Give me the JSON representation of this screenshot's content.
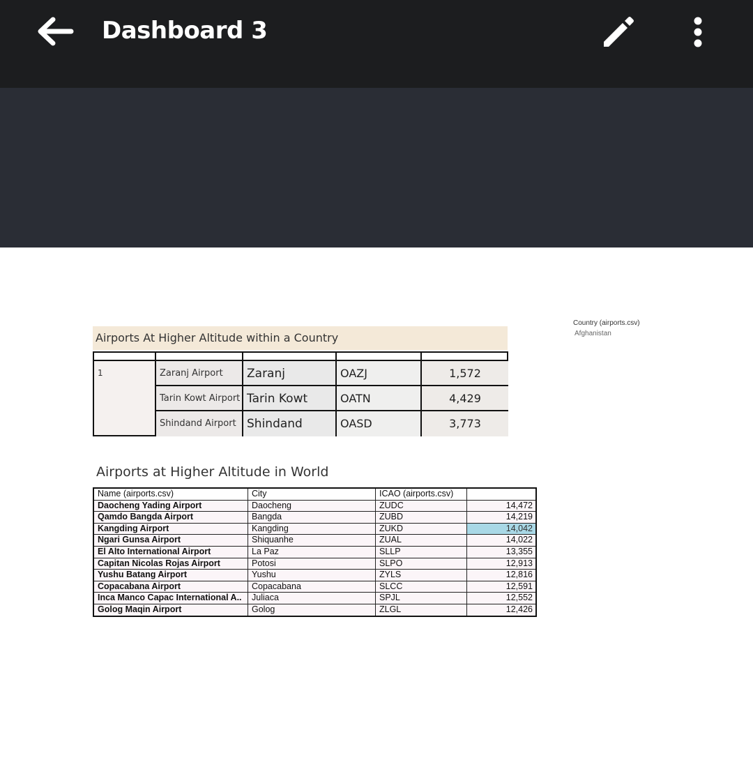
{
  "app_bar": {
    "title": "Dashboard 3",
    "back_icon": "arrow-left-icon",
    "edit_icon": "pencil-icon",
    "more_icon": "more-vert-icon"
  },
  "colors": {
    "app_bar": "#1c1d1f",
    "banner": "#2a2d35",
    "title_band": "#f4e9d8",
    "highlight_cell": "#a9d8e6"
  },
  "filter": {
    "label": "Country (airports.csv)",
    "value": "Afghanistan"
  },
  "country_table": {
    "title": "Airports At Higher Altitude within a Country",
    "rank": "1",
    "rows": [
      {
        "name": "Zaranj Airport",
        "city": "Zaranj",
        "icao": "OAZJ",
        "altitude": "1,572"
      },
      {
        "name": "Tarin Kowt Airport",
        "city": "Tarin Kowt",
        "icao": "OATN",
        "altitude": "4,429"
      },
      {
        "name": "Shindand Airport",
        "city": "Shindand",
        "icao": "OASD",
        "altitude": "3,773"
      }
    ]
  },
  "world_table": {
    "title": "Airports at Higher Altitude in World",
    "headers": {
      "name": "Name (airports.csv)",
      "city": "City",
      "icao": "ICAO (airports.csv)",
      "altitude": ""
    },
    "rows": [
      {
        "name": "Daocheng Yading Airport",
        "city": "Daocheng",
        "icao": "ZUDC",
        "altitude": "14,472"
      },
      {
        "name": "Qamdo Bangda Airport",
        "city": "Bangda",
        "icao": "ZUBD",
        "altitude": "14,219"
      },
      {
        "name": "Kangding Airport",
        "city": "Kangding",
        "icao": "ZUKD",
        "altitude": "14,042"
      },
      {
        "name": "Ngari Gunsa Airport",
        "city": "Shiquanhe",
        "icao": "ZUAL",
        "altitude": "14,022"
      },
      {
        "name": "El Alto International Airport",
        "city": "La Paz",
        "icao": "SLLP",
        "altitude": "13,355"
      },
      {
        "name": "Capitan Nicolas Rojas Airport",
        "city": "Potosi",
        "icao": "SLPO",
        "altitude": "12,913"
      },
      {
        "name": "Yushu Batang Airport",
        "city": "Yushu",
        "icao": "ZYLS",
        "altitude": "12,816"
      },
      {
        "name": "Copacabana Airport",
        "city": "Copacabana",
        "icao": "SLCC",
        "altitude": "12,591"
      },
      {
        "name": "Inca Manco Capac International A..",
        "city": "Juliaca",
        "icao": "SPJL",
        "altitude": "12,552"
      },
      {
        "name": "Golog Maqin Airport",
        "city": "Golog",
        "icao": "ZLGL",
        "altitude": "12,426"
      }
    ]
  }
}
